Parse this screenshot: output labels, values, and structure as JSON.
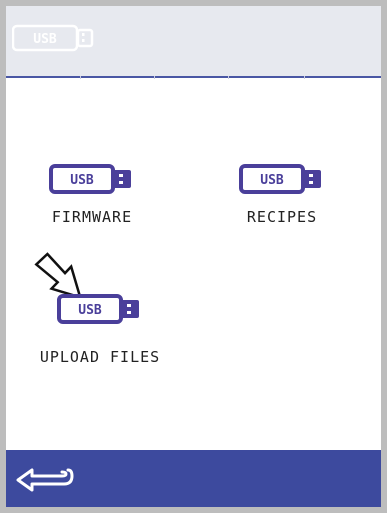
{
  "header": {
    "status_icon_label": "USB"
  },
  "tiles": [
    {
      "label": "FIRMWARE",
      "icon_label": "USB"
    },
    {
      "label": "RECIPES",
      "icon_label": "USB"
    },
    {
      "label": "UPLOAD FILES",
      "icon_label": "USB"
    }
  ],
  "colors": {
    "accent": "#3d4a9e",
    "icon_fill": "#4a3f9a",
    "header_bg": "#e7e9ef"
  },
  "footer": {
    "back_icon": "back-arrow-icon"
  }
}
